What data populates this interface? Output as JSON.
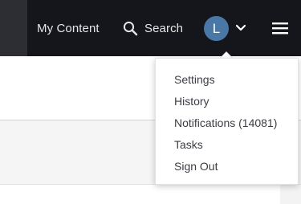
{
  "header": {
    "my_content_label": "My Content",
    "search_label": "Search",
    "avatar_initial": "L",
    "icons": {
      "search": "search-icon",
      "account_menu": "chevron-down-icon",
      "main_menu": "hamburger-menu-icon"
    }
  },
  "account_menu": {
    "items": [
      {
        "label": "Settings"
      },
      {
        "label": "History"
      },
      {
        "label": "Notifications (14081)"
      },
      {
        "label": "Tasks"
      },
      {
        "label": "Sign Out"
      }
    ]
  },
  "colors": {
    "topbar_bg": "#15161b",
    "avatar_bg": "#4a78a6",
    "nav_text": "#e6e6e8",
    "menu_text": "#3b3d44"
  }
}
